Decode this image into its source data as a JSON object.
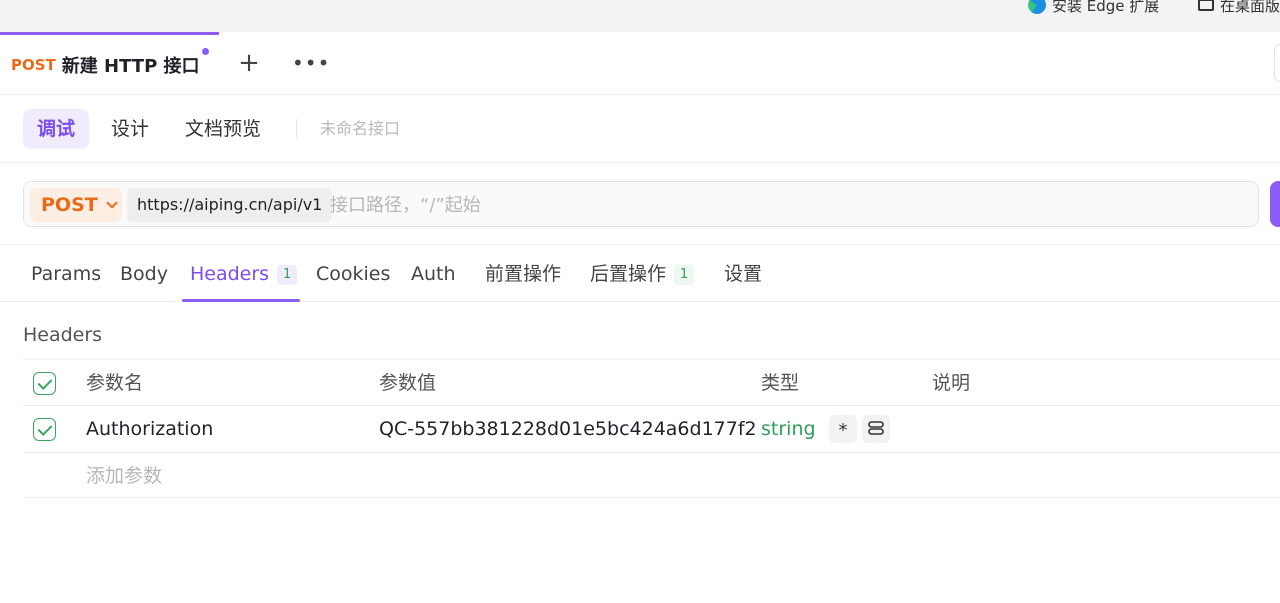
{
  "browser": {
    "install_label": "安装 Edge 扩展",
    "desktop_label": "在桌面版"
  },
  "tab": {
    "method": "POST",
    "title": "新建 HTTP 接口",
    "add_label": "+",
    "more_label": "•••"
  },
  "modes": {
    "items": [
      {
        "label": "调试"
      },
      {
        "label": "设计"
      },
      {
        "label": "文档预览"
      }
    ],
    "active": "调试",
    "api_name_placeholder": "未命名接口"
  },
  "url_bar": {
    "method": "POST",
    "base_url": "https://aiping.cn/api/v1",
    "path_value": "",
    "path_placeholder": "接口路径，“/”起始"
  },
  "request_tabs": {
    "items": [
      {
        "label": "Params"
      },
      {
        "label": "Body"
      },
      {
        "label": "Headers",
        "badge": "1"
      },
      {
        "label": "Cookies"
      },
      {
        "label": "Auth"
      },
      {
        "label": "前置操作"
      },
      {
        "label": "后置操作",
        "badge": "1"
      },
      {
        "label": "设置"
      }
    ],
    "active": "Headers"
  },
  "headers": {
    "section_title": "Headers",
    "columns": {
      "name": "参数名",
      "value": "参数值",
      "type": "类型",
      "description": "说明"
    },
    "rows": [
      {
        "enabled": true,
        "name": "Authorization",
        "value": "QC-557bb381228d01e5bc424a6d177f2",
        "type": "string",
        "required_mark": "*",
        "description": ""
      }
    ],
    "add_placeholder": "添加参数"
  },
  "colors": {
    "accent": "#8b5cf6",
    "method": "#ea6a1a",
    "success": "#2f9e56"
  },
  "icons": {
    "edge": "edge-icon",
    "desktop": "monitor-icon",
    "check": "check-icon",
    "chevron": "chevron-down-icon",
    "encoding": "link-icon"
  }
}
